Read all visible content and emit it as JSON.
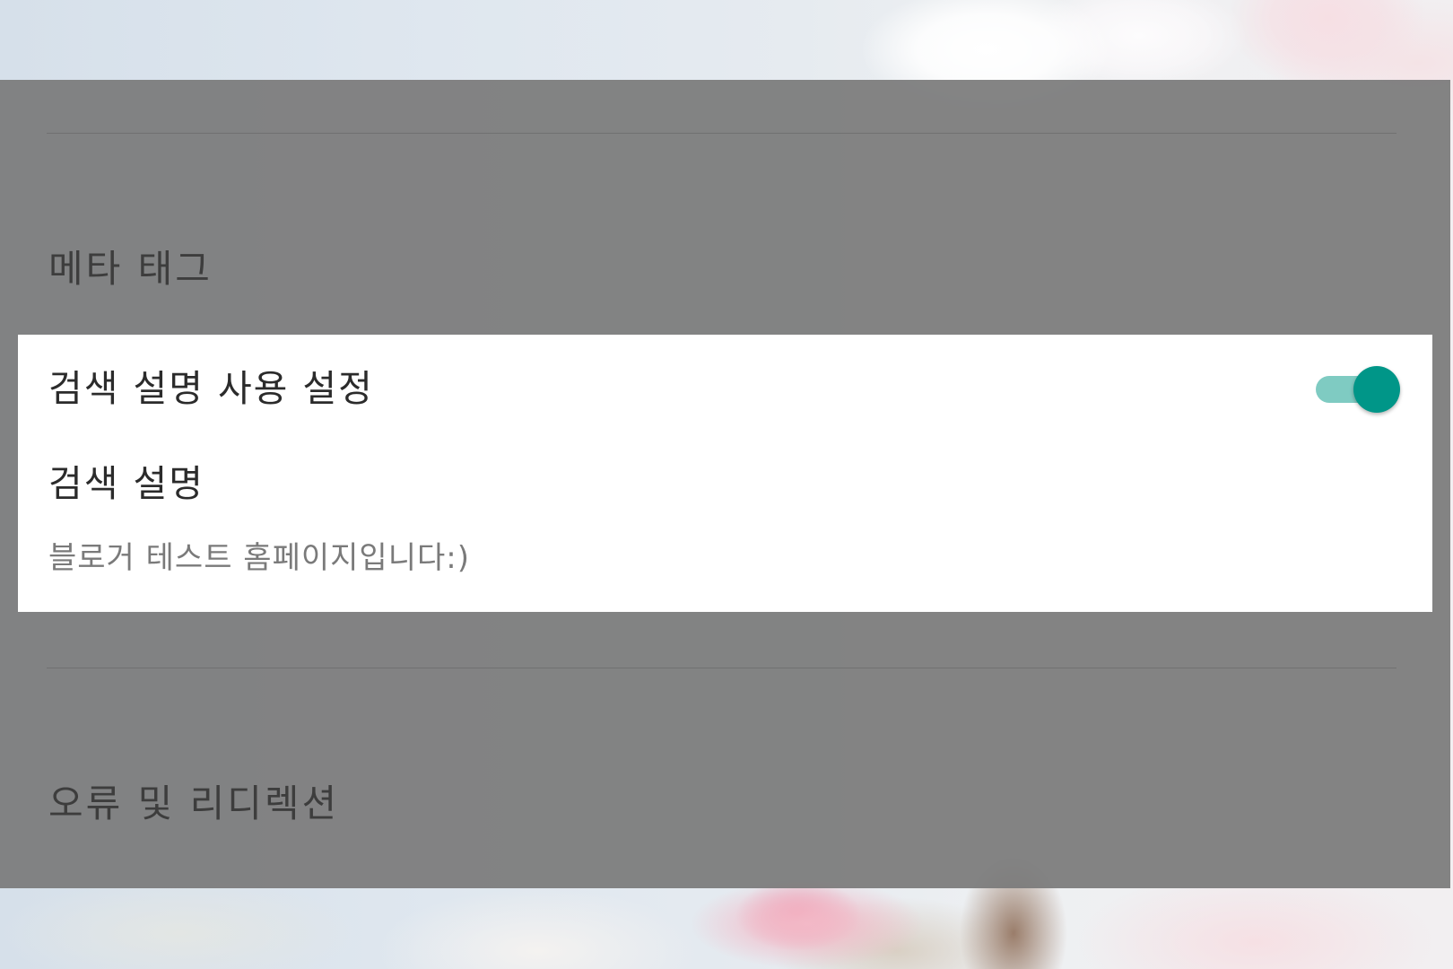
{
  "settings": {
    "meta_tags": {
      "title": "메타 태그"
    },
    "search_description_enable": {
      "label": "검색 설명 사용 설정",
      "enabled": true
    },
    "search_description": {
      "label": "검색 설명",
      "value": "블로거 테스트 홈페이지입니다:)"
    },
    "errors_redirects": {
      "title": "오류 및 리디렉션"
    }
  },
  "colors": {
    "toggle_thumb_on": "#009688",
    "toggle_track_on": "#7fcbc2",
    "overlay": "#7a7a7a",
    "card": "#ffffff"
  }
}
